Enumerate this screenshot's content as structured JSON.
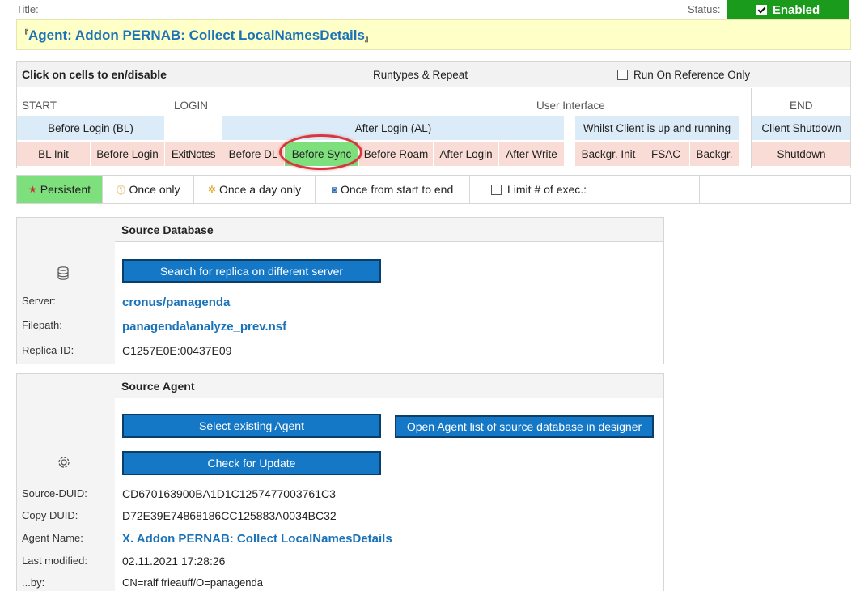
{
  "header": {
    "title_label": "Title:",
    "status_label": "Status:",
    "enabled_label": "Enabled",
    "title": "Agent: Addon PERNAB: Collect LocalNamesDetails",
    "corner_open": "『",
    "corner_close": "』"
  },
  "grid": {
    "header": {
      "click_hint": "Click on cells to en/disable",
      "runtypes": "Runtypes & Repeat",
      "reference_only": "Run On Reference Only"
    },
    "phases": {
      "start": "START",
      "login": "LOGIN",
      "ui": "User Interface",
      "end": "END"
    },
    "groups": {
      "before_login": "Before Login (BL)",
      "after_login": "After Login (AL)",
      "whilst": "Whilst Client is up and running",
      "client_shutdown": "Client Shutdown"
    },
    "cells": {
      "bl_init": "BL Init",
      "before_login": "Before Login",
      "exitnotes": "ExitNotes",
      "before_dl": "Before DL",
      "before_sync": "Before Sync",
      "before_roam": "Before Roam",
      "after_login": "After Login",
      "after_write": "After Write",
      "backgr_init": "Backgr. Init",
      "fsac": "FSAC",
      "backgr": "Backgr.",
      "shutdown": "Shutdown"
    }
  },
  "repeat": {
    "persistent": "Persistent",
    "once_only": "Once only",
    "once_a_day": "Once a day only",
    "once_start_end": "Once from start to end",
    "limit": "Limit # of exec.:"
  },
  "source_db": {
    "section_title": "Source Database",
    "search_button": "Search for replica on different server",
    "server_label": "Server:",
    "server": "cronus/panagenda",
    "filepath_label": "Filepath:",
    "filepath": "panagenda\\analyze_prev.nsf",
    "replica_label": "Replica-ID:",
    "replica_id": "C1257E0E:00437E09"
  },
  "source_agent": {
    "section_title": "Source Agent",
    "select_button": "Select existing Agent",
    "open_button": "Open Agent list of source database in designer",
    "check_button": "Check for Update",
    "duid_label": "Source-DUID:",
    "duid": "CD670163900BA1D1C1257477003761C3",
    "copy_duid_label": "Copy DUID:",
    "copy_duid": "D72E39E74868186CC125883A0034BC32",
    "agent_name_label": "Agent Name:",
    "agent_name": "X. Addon PERNAB: Collect LocalNamesDetails",
    "modified_label": "Last modified:",
    "modified": "02.11.2021 17:28:26",
    "by_label": "...by:",
    "by": "CN=ralf frieauff/O=panagenda"
  },
  "colors": {
    "accent_blue": "#1478c6",
    "enabled_green": "#1b9b1b",
    "active_cell": "#7de07d",
    "highlight_circle": "#d9363e"
  },
  "icons": {
    "database": "database-icon",
    "agent": "gear-icon",
    "persistent": "star-icon",
    "once": "info-icon",
    "day": "sun-icon",
    "start_end": "clock-icon"
  }
}
